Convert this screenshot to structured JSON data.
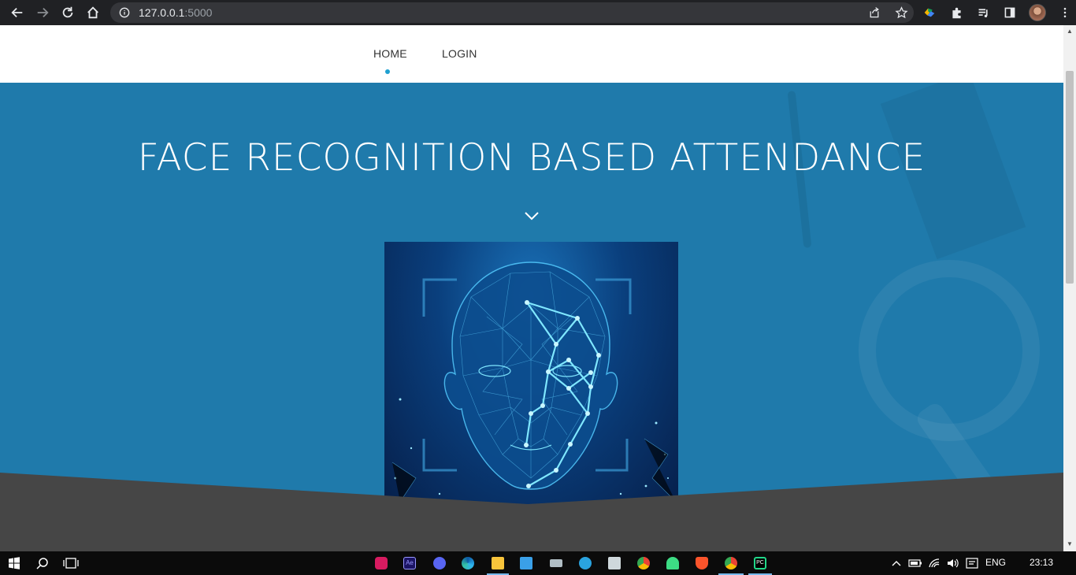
{
  "browser": {
    "url_host": "127.0.0.1",
    "url_port": ":5000"
  },
  "nav": {
    "items": [
      {
        "label": "HOME",
        "active": true
      },
      {
        "label": "LOGIN",
        "active": false
      }
    ],
    "accent": "#1fa0d0"
  },
  "hero": {
    "title": "FACE RECOGNITION BASED ATTENDANCE",
    "background": "#1f7aab",
    "bottom_color": "#464646"
  },
  "taskbar": {
    "language": "ENG",
    "time": "23:13"
  }
}
